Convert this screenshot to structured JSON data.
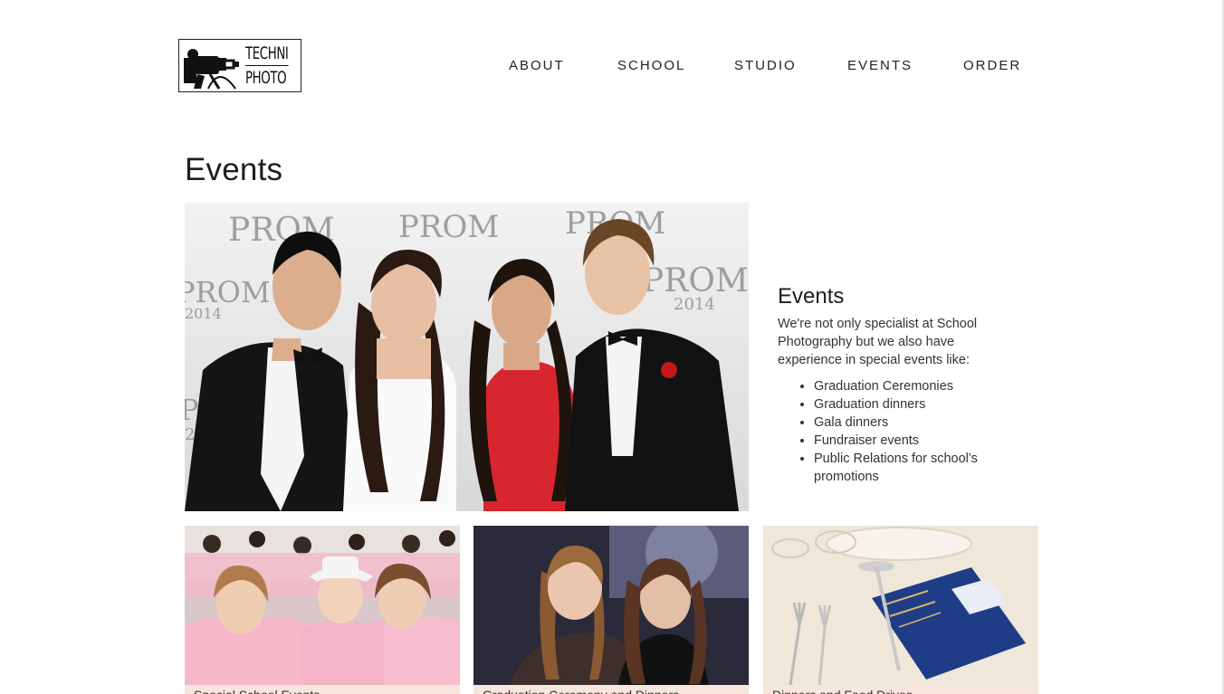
{
  "logo": {
    "line1": "TECHNI",
    "line2": "PHOTO"
  },
  "nav": [
    {
      "label": "ABOUT"
    },
    {
      "label": "SCHOOL"
    },
    {
      "label": "STUDIO"
    },
    {
      "label": "EVENTS"
    },
    {
      "label": "ORDER"
    }
  ],
  "page": {
    "title": "Events"
  },
  "hero": {
    "backdrop_text": "PROM",
    "backdrop_year": "2014"
  },
  "intro": {
    "heading": "Events",
    "text": "We're not only specialist at School Photography but we also have experience in special events like:",
    "items": [
      "Graduation Ceremonies",
      "Graduation dinners",
      "Gala dinners",
      "Fundraiser events",
      "Public Relations for school's promotions"
    ]
  },
  "thumbs": [
    {
      "caption": "Special School Events"
    },
    {
      "caption": "Graduation Ceremony and Dinners"
    },
    {
      "caption": "Dinners and Food Drives"
    }
  ],
  "colors": {
    "caption_bg": "#f7e6dc",
    "text": "#222222",
    "dress_red": "#d8262f"
  }
}
